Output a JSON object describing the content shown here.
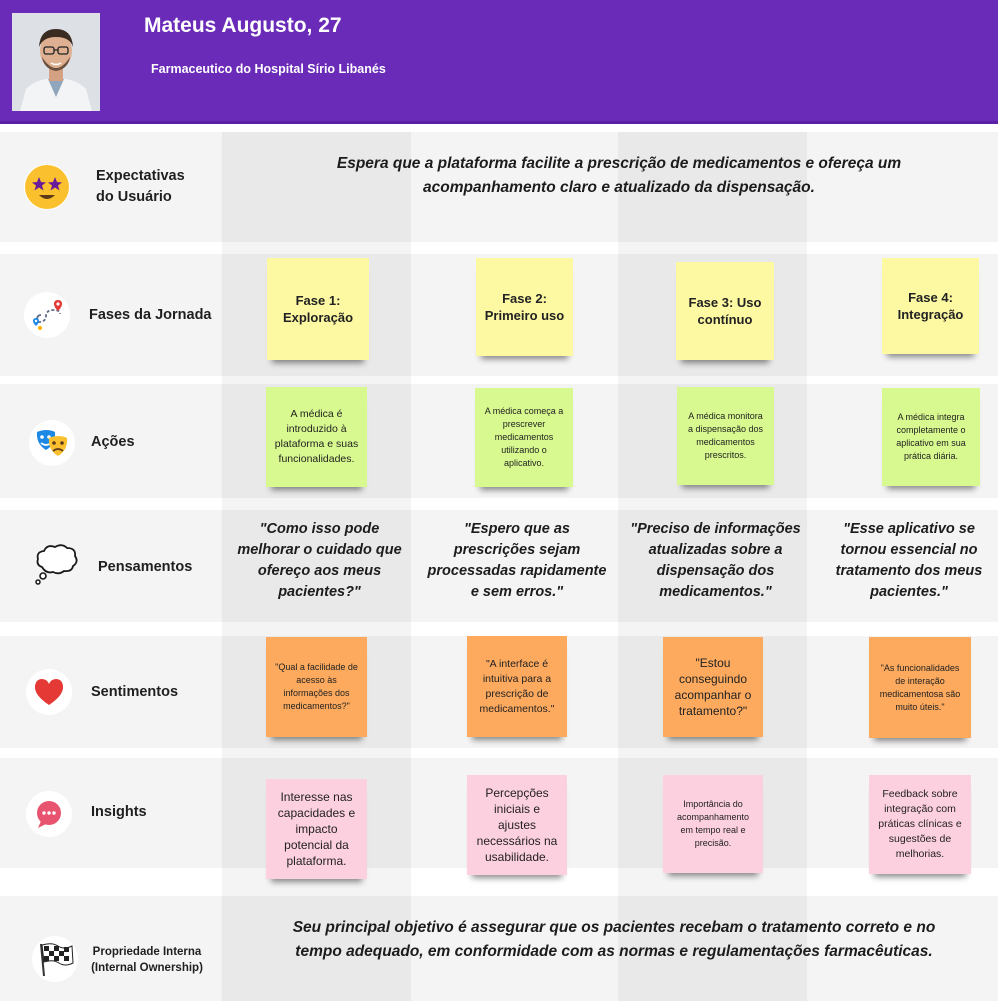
{
  "persona": {
    "name": "Mateus Augusto, 27",
    "role": "Farmaceutico do Hospital Sírio Libanés"
  },
  "rows": {
    "expectations": {
      "label": "Expectativas do Usuário",
      "icon": "star-struck-face-icon",
      "text": "Espera que a plataforma facilite a prescrição de medicamentos e ofereça um acompanhamento claro e atualizado da dispensação."
    },
    "phases": {
      "label": "Fases da Jornada",
      "icon": "route-map-icon",
      "items": [
        "Fase 1: Exploração",
        "Fase 2: Primeiro uso",
        "Fase 3: Uso contínuo",
        "Fase 4: Integração"
      ]
    },
    "actions": {
      "label": "Ações",
      "icon": "theater-masks-icon",
      "items": [
        "A médica é introduzido à plataforma e suas funcionalidades.",
        "A médica começa a prescrever medicamentos utilizando o aplicativo.",
        "A médica monitora a dispensação dos medicamentos prescritos.",
        "A médica integra completamente o aplicativo em sua prática diária."
      ]
    },
    "thoughts": {
      "label": "Pensamentos",
      "icon": "thought-bubble-icon",
      "items": [
        "\"Como isso pode melhorar o cuidado que ofereço aos meus pacientes?\"",
        "\"Espero que as prescrições sejam processadas rapidamente e sem erros.\"",
        "\"Preciso de informações atualizadas sobre a dispensação dos medicamentos.\"",
        "\"Esse aplicativo se tornou essencial no tratamento dos meus pacientes.\""
      ]
    },
    "feelings": {
      "label": "Sentimentos",
      "icon": "heart-icon",
      "items": [
        "\"Qual a facilidade de acesso às informações dos medicamentos?\"",
        "\"A interface é intuitiva para a prescrição de medicamentos.\"",
        "\"Estou conseguindo acompanhar o tratamento?\"",
        "\"As funcionalidades de interação medicamentosa são muito úteis.\""
      ]
    },
    "insights": {
      "label": "Insights",
      "icon": "chat-bubble-icon",
      "items": [
        "Interesse nas capacidades e impacto potencial da plataforma.",
        "Percepções iniciais e ajustes necessários na usabilidade.",
        "Importância do acompanhamento em tempo real e precisão.",
        "Feedback sobre integração com práticas clínicas e sugestões de melhorias."
      ]
    },
    "ownership": {
      "label": "Propriedade Interna (Internal Ownership)",
      "icon": "checkered-flag-icon",
      "text": "Seu principal objetivo é assegurar que os pacientes recebam o tratamento correto e no tempo adequado, em conformidade com as normas e  regulamentações farmacêuticas."
    }
  }
}
